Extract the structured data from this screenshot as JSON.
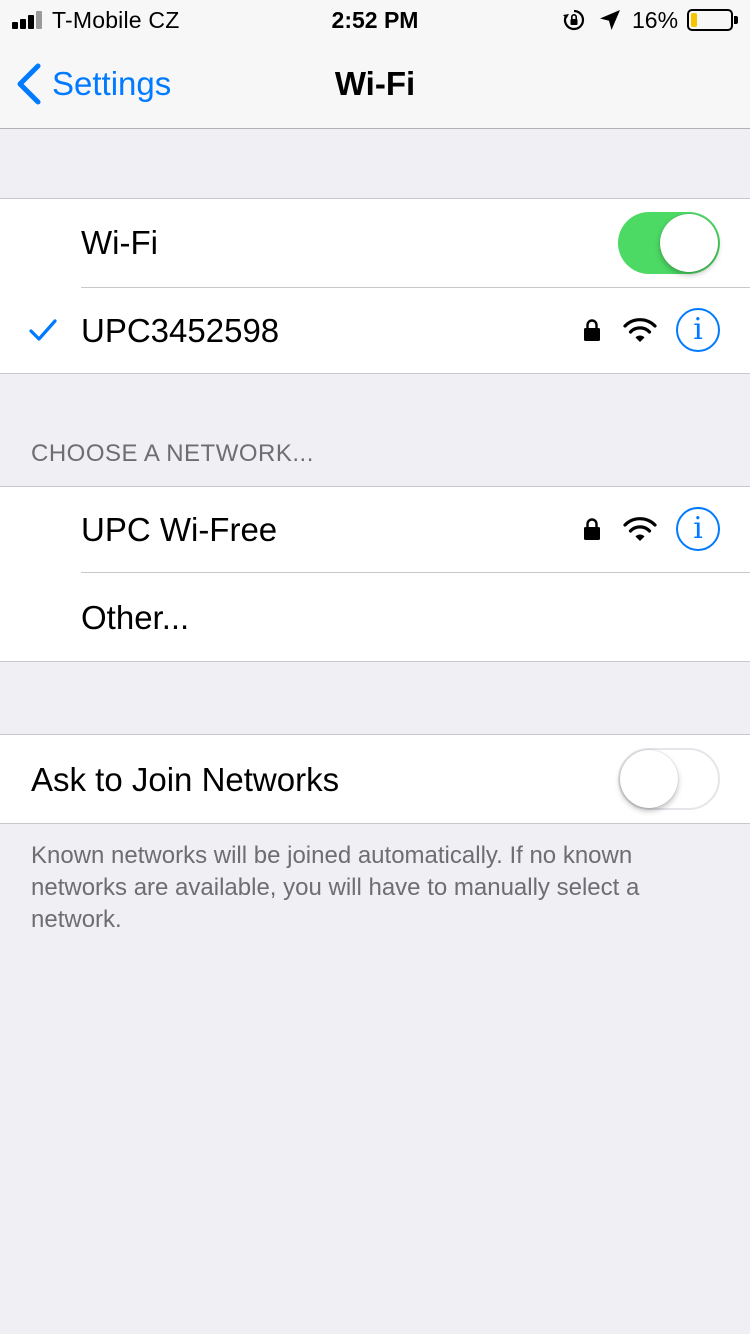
{
  "status_bar": {
    "carrier": "T-Mobile CZ",
    "time": "2:52 PM",
    "battery_percent": "16%",
    "battery_level": 0.16,
    "battery_color": "#f7c500"
  },
  "nav": {
    "back_label": "Settings",
    "title": "Wi-Fi"
  },
  "wifi_toggle": {
    "label": "Wi-Fi",
    "on": true
  },
  "connected_network": {
    "name": "UPC3452598",
    "secured": true,
    "connected": true
  },
  "choose_header": "CHOOSE A NETWORK...",
  "networks": [
    {
      "name": "UPC Wi-Free",
      "secured": true
    }
  ],
  "other_label": "Other...",
  "ask_to_join": {
    "label": "Ask to Join Networks",
    "on": false
  },
  "footer_text": "Known networks will be joined automatically. If no known networks are available, you will have to manually select a network.",
  "colors": {
    "accent": "#007aff",
    "switch_on": "#4cd964",
    "background": "#efeff4"
  }
}
